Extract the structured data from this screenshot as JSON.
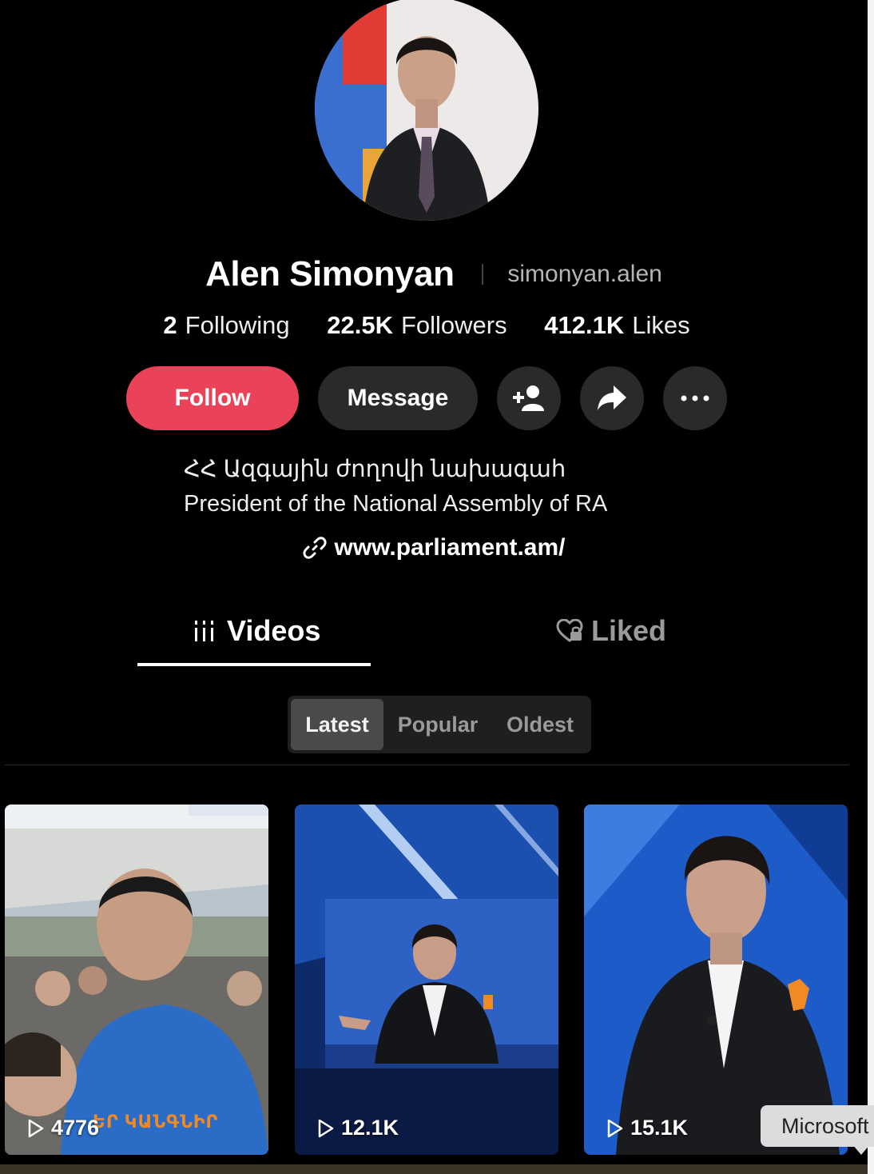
{
  "profile": {
    "display_name": "Alen Simonyan",
    "username": "simonyan.alen",
    "avatar_icon": "avatar-photo"
  },
  "stats": [
    {
      "value": "2",
      "label": "Following"
    },
    {
      "value": "22.5K",
      "label": "Followers"
    },
    {
      "value": "412.1K",
      "label": "Likes"
    }
  ],
  "actions": {
    "follow_label": "Follow",
    "message_label": "Message",
    "add_friend_icon": "add-friend-icon",
    "share_icon": "share-icon",
    "more_icon": "more-icon"
  },
  "bio": {
    "line1": "ՀՀ Ազգային ժողովի նախագահ",
    "line2": "President of the National Assembly of RA",
    "link": "www.parliament.am/"
  },
  "tabs": [
    {
      "label": "Videos",
      "icon": "grid-icon",
      "active": true
    },
    {
      "label": "Liked",
      "icon": "liked-locked-icon",
      "active": false
    }
  ],
  "sort": {
    "options": [
      "Latest",
      "Popular",
      "Oldest"
    ],
    "selected": "Latest"
  },
  "videos": [
    {
      "views": "4776",
      "overlay_text": "ԵՐ ԿԱՆԳՆԻՐ"
    },
    {
      "views": "12.1K"
    },
    {
      "views": "15.1K"
    }
  ],
  "tooltip": {
    "text": "Microsoft"
  },
  "colors": {
    "background": "#000000",
    "follow_button": "#ea4359",
    "secondary_button": "#2a2a2a",
    "muted_text": "#9a9a9a"
  }
}
